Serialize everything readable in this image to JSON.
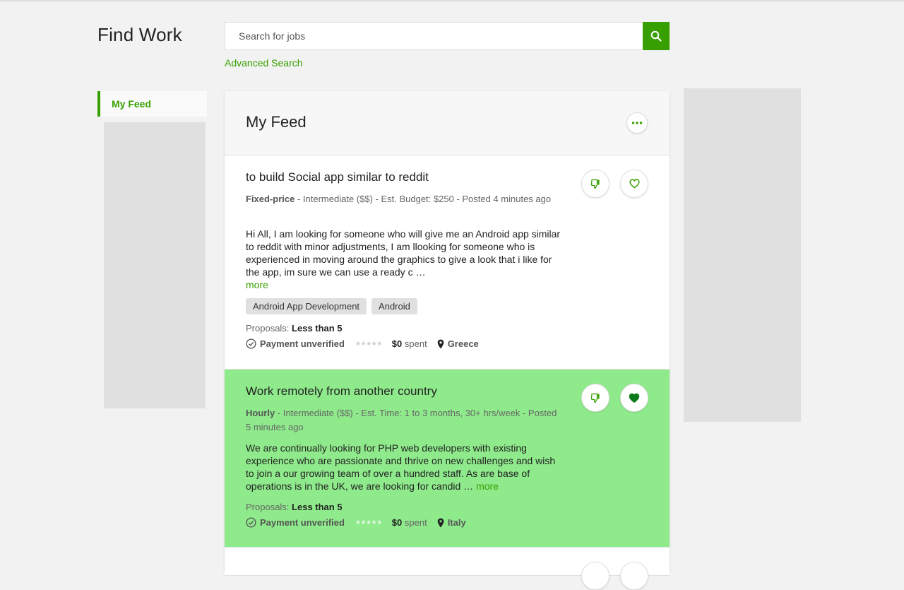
{
  "header": {
    "title": "Find Work",
    "search_placeholder": "Search for jobs",
    "advanced_search": "Advanced Search"
  },
  "sidebar": {
    "items": [
      {
        "label": "My Feed",
        "active": true
      }
    ]
  },
  "feed": {
    "title": "My Feed",
    "jobs": [
      {
        "title": "to build Social app similar to reddit",
        "type": "Fixed-price",
        "meta": " - Intermediate ($$) - Est. Budget: $250 - Posted 4 minutes ago",
        "description": "Hi All, I am looking for someone who will give me an Android app similar to reddit with minor adjustments, I am llooking for someone who is experienced in moving around the graphics to give a look that i like for the app, im sure we can use a ready c …",
        "more": "more",
        "tags": [
          "Android App Development",
          "Android"
        ],
        "proposals_label": "Proposals:",
        "proposals_value": "Less than 5",
        "payment": "Payment unverified",
        "spent_amount": "$0",
        "spent_label": "spent",
        "location": "Greece",
        "rating": 0,
        "saved": false
      },
      {
        "title": "Work remotely from another country",
        "type": "Hourly",
        "meta": " - Intermediate ($$) - Est. Time: 1 to 3 months, 30+ hrs/week - Posted 5 minutes ago",
        "description": "We are continually looking for PHP web developers with existing experience who are passionate and thrive on new challenges and wish to join a our growing team of over a hundred staff. As are base of operations is in the UK, we are looking for candid …",
        "more": "more",
        "tags": [],
        "proposals_label": "Proposals:",
        "proposals_value": "Less than 5",
        "payment": "Payment unverified",
        "spent_amount": "$0",
        "spent_label": "spent",
        "location": "Italy",
        "rating": 0,
        "saved": true
      }
    ]
  },
  "colors": {
    "accent": "#37a000",
    "highlight_row": "#8fea8c",
    "saved_heart": "#0d7a1a",
    "background": "#f2f2f2",
    "placeholder_block": "#e0e0e0"
  }
}
